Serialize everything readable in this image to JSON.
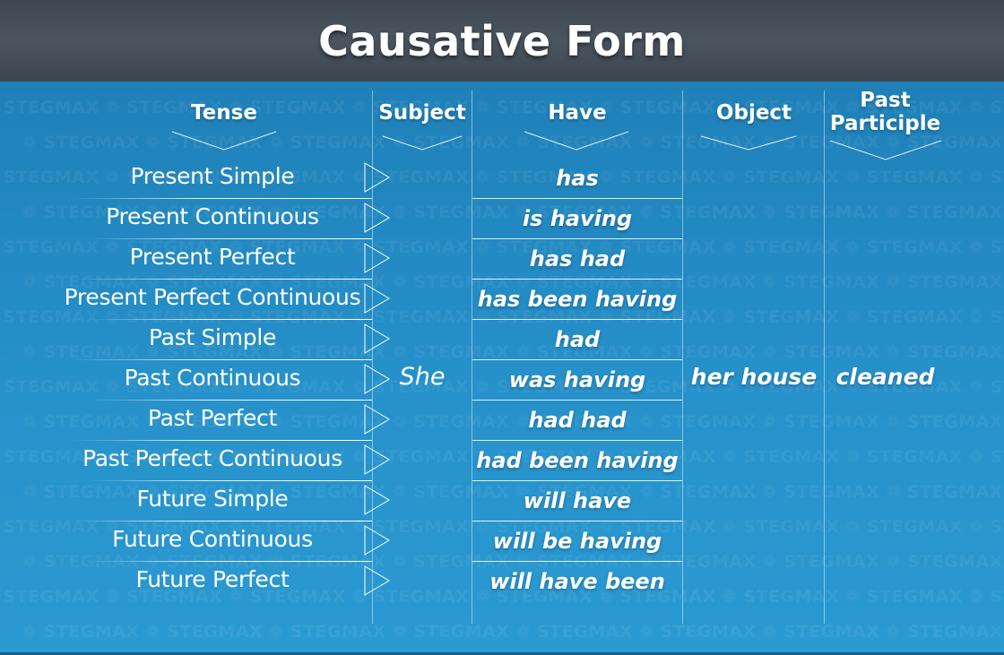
{
  "title": "Causative Form",
  "watermark_text": "STEGMAX",
  "columns": {
    "tense": "Tense",
    "subject": "Subject",
    "have": "Have",
    "object": "Object",
    "past_participle_line1": "Past",
    "past_participle_line2": "Participle"
  },
  "rows": [
    {
      "tense": "Present Simple",
      "have": "has"
    },
    {
      "tense": "Present Continuous",
      "have": "is having"
    },
    {
      "tense": "Present Perfect",
      "have": "has had"
    },
    {
      "tense": "Present Perfect Continuous",
      "have": "has been having"
    },
    {
      "tense": "Past Simple",
      "have": "had"
    },
    {
      "tense": "Past Continuous",
      "have": "was having"
    },
    {
      "tense": "Past Perfect",
      "have": "had had"
    },
    {
      "tense": "Past Perfect Continuous",
      "have": "had been having"
    },
    {
      "tense": "Future Simple",
      "have": "will have"
    },
    {
      "tense": "Future Continuous",
      "have": "will be having"
    },
    {
      "tense": "Future Perfect",
      "have": "will have been"
    }
  ],
  "subject_value": "She",
  "object_value": "her house",
  "participle_value": "cleaned",
  "colors": {
    "header_bg": "#434d57",
    "body_bg": "#2690c9",
    "text": "#ffffff"
  }
}
